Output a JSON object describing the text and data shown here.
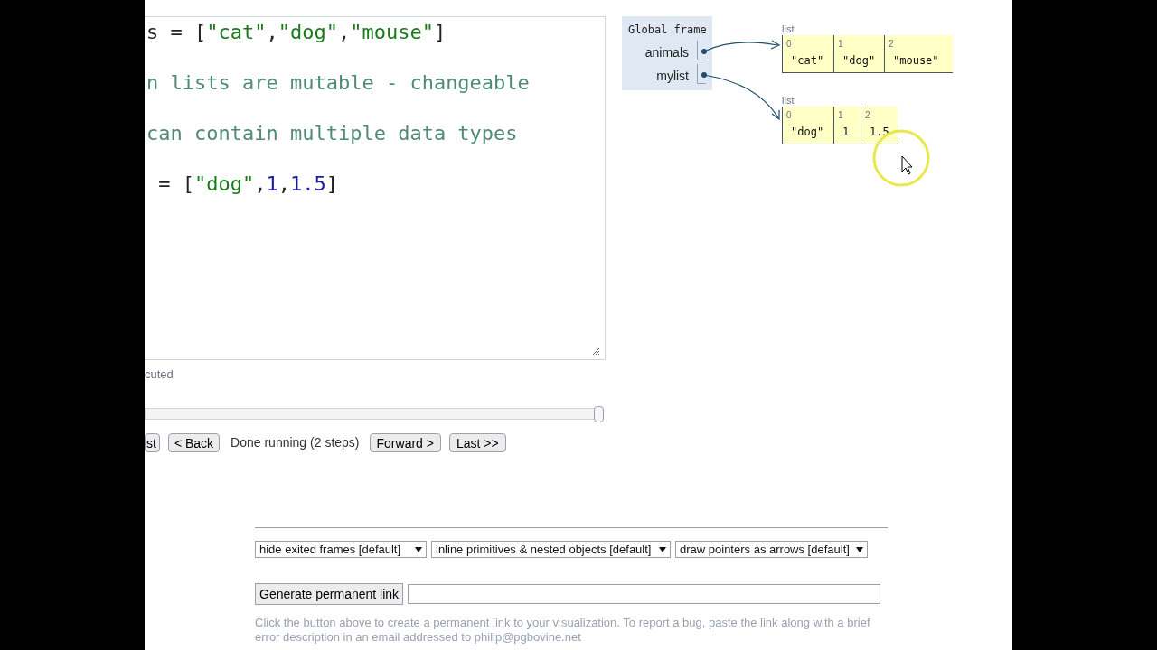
{
  "code_editor": {
    "lines": [
      {
        "tokens": [
          {
            "kind": "plain",
            "text": "s = ["
          },
          {
            "kind": "string",
            "text": "\"cat\""
          },
          {
            "kind": "plain",
            "text": ","
          },
          {
            "kind": "string",
            "text": "\"dog\""
          },
          {
            "kind": "plain",
            "text": ","
          },
          {
            "kind": "string",
            "text": "\"mouse\""
          },
          {
            "kind": "plain",
            "text": "]"
          }
        ]
      },
      {
        "tokens": [
          {
            "kind": "comment",
            "text": "n lists are mutable - changeable"
          }
        ]
      },
      {
        "tokens": [
          {
            "kind": "comment",
            "text": "can contain multiple data types"
          }
        ]
      },
      {
        "tokens": [
          {
            "kind": "plain",
            "text": " = ["
          },
          {
            "kind": "string",
            "text": "\"dog\""
          },
          {
            "kind": "plain",
            "text": ","
          },
          {
            "kind": "number",
            "text": "1"
          },
          {
            "kind": "plain",
            "text": ","
          },
          {
            "kind": "number",
            "text": "1.5"
          },
          {
            "kind": "plain",
            "text": "]"
          }
        ]
      }
    ]
  },
  "status": "cuted",
  "step_slider": {
    "level": 1
  },
  "navigation": {
    "first": "st",
    "back": "< Back",
    "message": "Done running (2 steps)",
    "forward": "Forward >",
    "last": "Last >>"
  },
  "frame": {
    "title": "Global frame",
    "variables": [
      {
        "name": "animals"
      },
      {
        "name": "mylist"
      }
    ]
  },
  "heap": [
    {
      "label": "list",
      "items": [
        {
          "index": "0",
          "value": "\"cat\""
        },
        {
          "index": "1",
          "value": "\"dog\""
        },
        {
          "index": "2",
          "value": "\"mouse\""
        }
      ]
    },
    {
      "label": "list",
      "items": [
        {
          "index": "0",
          "value": "\"dog\""
        },
        {
          "index": "1",
          "value": "1"
        },
        {
          "index": "2",
          "value": "1.5"
        }
      ]
    }
  ],
  "options": [
    "hide exited frames [default]",
    "inline primitives & nested objects [default]",
    "draw pointers as arrows [default]"
  ],
  "permalink": {
    "button": "Generate permanent link"
  },
  "note": "Click the button above to create a permanent link to your visualization. To report a bug, paste the link along with a brief error description in an email addressed to philip@pgbovine.net"
}
